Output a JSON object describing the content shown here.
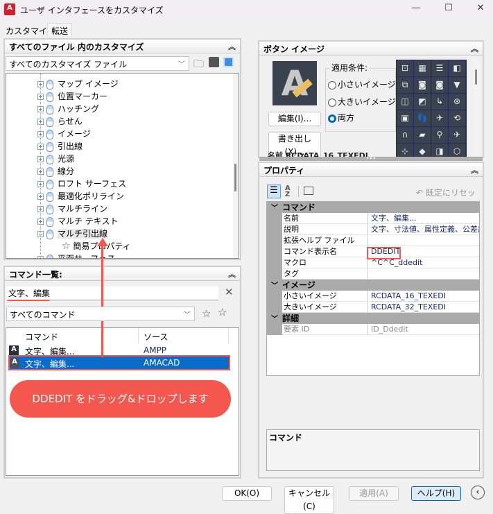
{
  "window": {
    "title": "ユーザ インタフェースをカスタマイズ",
    "logo": "A",
    "minimize": "—",
    "maximize": "☐",
    "close": "✕"
  },
  "tabs": [
    {
      "label": "カスタマイズ",
      "active": true
    },
    {
      "label": "転送",
      "active": false
    }
  ],
  "customizations_panel": {
    "title": "すべてのファイル 内のカスタマイズ",
    "file_select": "すべてのカスタマイズ ファイル",
    "tree": [
      {
        "label": "マップ イメージ",
        "exp": "+"
      },
      {
        "label": "位置マーカー",
        "exp": "+"
      },
      {
        "label": "ハッチング",
        "exp": "+"
      },
      {
        "label": "らせん",
        "exp": "+"
      },
      {
        "label": "イメージ",
        "exp": "+"
      },
      {
        "label": "引出線",
        "exp": "+"
      },
      {
        "label": "光源",
        "exp": "+"
      },
      {
        "label": "線分",
        "exp": "+"
      },
      {
        "label": "ロフト サーフェス",
        "exp": "+"
      },
      {
        "label": "最適化ポリライン",
        "exp": "+"
      },
      {
        "label": "マルチライン",
        "exp": "+"
      },
      {
        "label": "マルチ テキスト",
        "exp": "+"
      },
      {
        "label": "マルチ引出線",
        "exp": "−"
      },
      {
        "label": "簡易プロパティ",
        "child": true
      },
      {
        "label": "平面サーフェス",
        "exp": "+"
      }
    ]
  },
  "command_list": {
    "title": "コマンド一覧:",
    "search_value": "文字、編集",
    "filter": "すべてのコマンド",
    "columns": [
      "コマンド",
      "ソース"
    ],
    "rows": [
      {
        "command": "文字、編集...",
        "source": "AMPP",
        "selected": false
      },
      {
        "command": "文字、編集...",
        "source": "AMACAD",
        "selected": true
      }
    ]
  },
  "annotation": {
    "callout": "DDEDIT をドラッグ&ドロップします",
    "color": "#f4574d"
  },
  "button_image": {
    "title": "ボタン イメージ",
    "apply_label": "適用条件:",
    "options": [
      "小さいイメージ",
      "大きいイメージ",
      "両方"
    ],
    "selected": "両方",
    "edit": "編集(I)...",
    "export": "書き出し(X)...",
    "name_partial": "名前     RCDATA_16_TEXEDI"
  },
  "properties": {
    "title": "プロパティ",
    "reset": "既定にリセット",
    "categories": [
      {
        "name": "コマンド",
        "rows": [
          {
            "k": "名前",
            "v": "文字、編集..."
          },
          {
            "k": "説明",
            "v": "文字、寸法値、属性定義、公差記"
          },
          {
            "k": "拡張ヘルプ ファイル",
            "v": ""
          },
          {
            "k": "コマンド表示名",
            "v": "DDEDIT"
          },
          {
            "k": "マクロ",
            "v": "^C^C_ddedit"
          },
          {
            "k": "タグ",
            "v": ""
          }
        ]
      },
      {
        "name": "イメージ",
        "rows": [
          {
            "k": "小さいイメージ",
            "v": "RCDATA_16_TEXEDI"
          },
          {
            "k": "大きいイメージ",
            "v": "RCDATA_32_TEXEDI"
          }
        ]
      },
      {
        "name": "詳細",
        "rows": [
          {
            "k": "要素 ID",
            "v": "ID_Ddedit"
          }
        ]
      }
    ],
    "description_title": "コマンド"
  },
  "footer": {
    "ok": "OK(O)",
    "cancel": "キャンセル(C)",
    "apply": "適用(A)",
    "help": "ヘルプ(H)"
  }
}
